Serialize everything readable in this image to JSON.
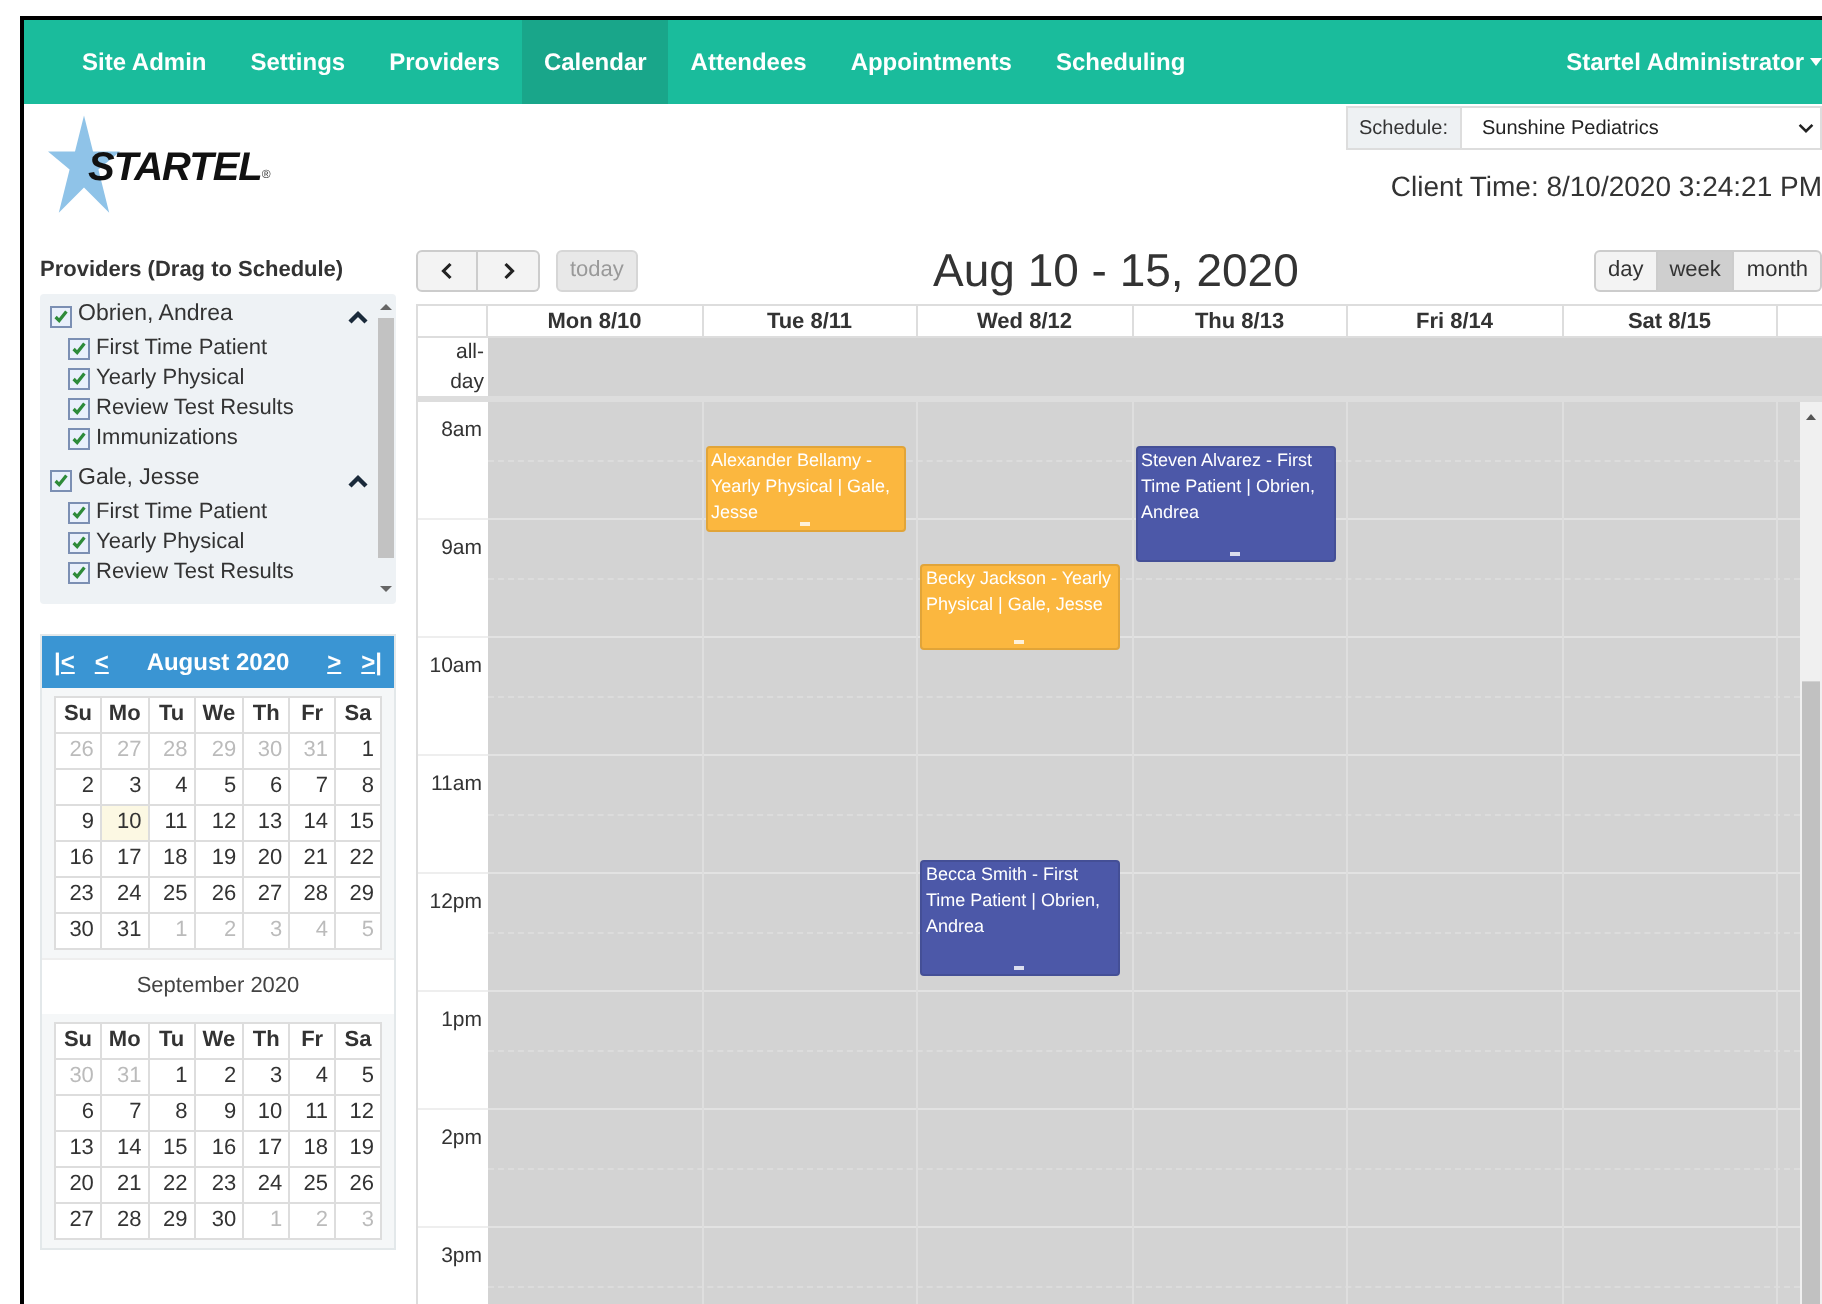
{
  "nav": {
    "items": [
      {
        "label": "Site Admin",
        "selected": false
      },
      {
        "label": "Settings",
        "selected": false
      },
      {
        "label": "Providers",
        "selected": false
      },
      {
        "label": "Calendar",
        "selected": true
      },
      {
        "label": "Attendees",
        "selected": false
      },
      {
        "label": "Appointments",
        "selected": false
      },
      {
        "label": "Scheduling",
        "selected": false
      }
    ],
    "user": "Startel Administrator"
  },
  "logo": {
    "text": "STARTEL",
    "mark": "®"
  },
  "schedule": {
    "label": "Schedule:",
    "value": "Sunshine Pediatrics"
  },
  "client_time": "Client Time: 8/10/2020 3:24:21 PM",
  "providers": {
    "title": "Providers (Drag to Schedule)",
    "items": [
      {
        "name": "Obrien, Andrea",
        "checked": true,
        "expanded": true,
        "children": [
          {
            "label": "First Time Patient",
            "checked": true
          },
          {
            "label": "Yearly Physical",
            "checked": true
          },
          {
            "label": "Review Test Results",
            "checked": true
          },
          {
            "label": "Immunizations",
            "checked": true
          }
        ]
      },
      {
        "name": "Gale, Jesse",
        "checked": true,
        "expanded": true,
        "children": [
          {
            "label": "First Time Patient",
            "checked": true
          },
          {
            "label": "Yearly Physical",
            "checked": true
          },
          {
            "label": "Review Test Results",
            "checked": true
          }
        ]
      }
    ]
  },
  "mini_calendars": [
    {
      "title": "August 2020",
      "nav": [
        "|<",
        "<",
        ">",
        ">|"
      ],
      "weekdays": [
        "Su",
        "Mo",
        "Tu",
        "We",
        "Th",
        "Fr",
        "Sa"
      ],
      "weeks": [
        [
          {
            "day": "26",
            "muted": true,
            "today": false
          },
          {
            "day": "27",
            "muted": true,
            "today": false
          },
          {
            "day": "28",
            "muted": true,
            "today": false
          },
          {
            "day": "29",
            "muted": true,
            "today": false
          },
          {
            "day": "30",
            "muted": true,
            "today": false
          },
          {
            "day": "31",
            "muted": true,
            "today": false
          },
          {
            "day": "1",
            "muted": false,
            "today": false
          }
        ],
        [
          {
            "day": "2",
            "muted": false,
            "today": false
          },
          {
            "day": "3",
            "muted": false,
            "today": false
          },
          {
            "day": "4",
            "muted": false,
            "today": false
          },
          {
            "day": "5",
            "muted": false,
            "today": false
          },
          {
            "day": "6",
            "muted": false,
            "today": false
          },
          {
            "day": "7",
            "muted": false,
            "today": false
          },
          {
            "day": "8",
            "muted": false,
            "today": false
          }
        ],
        [
          {
            "day": "9",
            "muted": false,
            "today": false
          },
          {
            "day": "10",
            "muted": false,
            "today": true
          },
          {
            "day": "11",
            "muted": false,
            "today": false
          },
          {
            "day": "12",
            "muted": false,
            "today": false
          },
          {
            "day": "13",
            "muted": false,
            "today": false
          },
          {
            "day": "14",
            "muted": false,
            "today": false
          },
          {
            "day": "15",
            "muted": false,
            "today": false
          }
        ],
        [
          {
            "day": "16",
            "muted": false,
            "today": false
          },
          {
            "day": "17",
            "muted": false,
            "today": false
          },
          {
            "day": "18",
            "muted": false,
            "today": false
          },
          {
            "day": "19",
            "muted": false,
            "today": false
          },
          {
            "day": "20",
            "muted": false,
            "today": false
          },
          {
            "day": "21",
            "muted": false,
            "today": false
          },
          {
            "day": "22",
            "muted": false,
            "today": false
          }
        ],
        [
          {
            "day": "23",
            "muted": false,
            "today": false
          },
          {
            "day": "24",
            "muted": false,
            "today": false
          },
          {
            "day": "25",
            "muted": false,
            "today": false
          },
          {
            "day": "26",
            "muted": false,
            "today": false
          },
          {
            "day": "27",
            "muted": false,
            "today": false
          },
          {
            "day": "28",
            "muted": false,
            "today": false
          },
          {
            "day": "29",
            "muted": false,
            "today": false
          }
        ],
        [
          {
            "day": "30",
            "muted": false,
            "today": false
          },
          {
            "day": "31",
            "muted": false,
            "today": false
          },
          {
            "day": "1",
            "muted": true,
            "today": false
          },
          {
            "day": "2",
            "muted": true,
            "today": false
          },
          {
            "day": "3",
            "muted": true,
            "today": false
          },
          {
            "day": "4",
            "muted": true,
            "today": false
          },
          {
            "day": "5",
            "muted": true,
            "today": false
          }
        ]
      ]
    },
    {
      "title": "September 2020",
      "weekdays": [
        "Su",
        "Mo",
        "Tu",
        "We",
        "Th",
        "Fr",
        "Sa"
      ],
      "weeks": [
        [
          {
            "day": "30",
            "muted": true,
            "today": false
          },
          {
            "day": "31",
            "muted": true,
            "today": false
          },
          {
            "day": "1",
            "muted": false,
            "today": false
          },
          {
            "day": "2",
            "muted": false,
            "today": false
          },
          {
            "day": "3",
            "muted": false,
            "today": false
          },
          {
            "day": "4",
            "muted": false,
            "today": false
          },
          {
            "day": "5",
            "muted": false,
            "today": false
          }
        ],
        [
          {
            "day": "6",
            "muted": false,
            "today": false
          },
          {
            "day": "7",
            "muted": false,
            "today": false
          },
          {
            "day": "8",
            "muted": false,
            "today": false
          },
          {
            "day": "9",
            "muted": false,
            "today": false
          },
          {
            "day": "10",
            "muted": false,
            "today": false
          },
          {
            "day": "11",
            "muted": false,
            "today": false
          },
          {
            "day": "12",
            "muted": false,
            "today": false
          }
        ],
        [
          {
            "day": "13",
            "muted": false,
            "today": false
          },
          {
            "day": "14",
            "muted": false,
            "today": false
          },
          {
            "day": "15",
            "muted": false,
            "today": false
          },
          {
            "day": "16",
            "muted": false,
            "today": false
          },
          {
            "day": "17",
            "muted": false,
            "today": false
          },
          {
            "day": "18",
            "muted": false,
            "today": false
          },
          {
            "day": "19",
            "muted": false,
            "today": false
          }
        ],
        [
          {
            "day": "20",
            "muted": false,
            "today": false
          },
          {
            "day": "21",
            "muted": false,
            "today": false
          },
          {
            "day": "22",
            "muted": false,
            "today": false
          },
          {
            "day": "23",
            "muted": false,
            "today": false
          },
          {
            "day": "24",
            "muted": false,
            "today": false
          },
          {
            "day": "25",
            "muted": false,
            "today": false
          },
          {
            "day": "26",
            "muted": false,
            "today": false
          }
        ],
        [
          {
            "day": "27",
            "muted": false,
            "today": false
          },
          {
            "day": "28",
            "muted": false,
            "today": false
          },
          {
            "day": "29",
            "muted": false,
            "today": false
          },
          {
            "day": "30",
            "muted": false,
            "today": false
          },
          {
            "day": "1",
            "muted": true,
            "today": false
          },
          {
            "day": "2",
            "muted": true,
            "today": false
          },
          {
            "day": "3",
            "muted": true,
            "today": false
          }
        ]
      ]
    }
  ],
  "calendar": {
    "today": {
      "label": "today",
      "disabled": true
    },
    "title": "Aug 10 - 15, 2020",
    "views": [
      {
        "label": "day",
        "selected": false
      },
      {
        "label": "week",
        "selected": true
      },
      {
        "label": "month",
        "selected": false
      }
    ],
    "days": [
      {
        "label": "Mon 8/10"
      },
      {
        "label": "Tue 8/11",
        "events": [
          {
            "text": "Alexander Bellamy - Yearly Physical | Gale, Jesse",
            "color": "#fbb73f"
          }
        ]
      },
      {
        "label": "Wed 8/12",
        "events": [
          {
            "text": "Becky Jackson - Yearly Physical | Gale, Jesse",
            "color": "#fbb73f"
          },
          {
            "text": "Becca Smith - First Time Patient | Obrien, Andrea",
            "color": "#4c58a8"
          }
        ]
      },
      {
        "label": "Thu 8/13",
        "events": [
          {
            "text": "Steven Alvarez - First Time Patient | Obrien, Andrea",
            "color": "#4c58a8"
          }
        ]
      },
      {
        "label": "Fri 8/14"
      },
      {
        "label": "Sat 8/15"
      }
    ],
    "all_day": "all-day",
    "times": [
      "8am",
      "9am",
      "10am",
      "11am",
      "12pm",
      "1pm",
      "2pm",
      "3pm"
    ]
  }
}
